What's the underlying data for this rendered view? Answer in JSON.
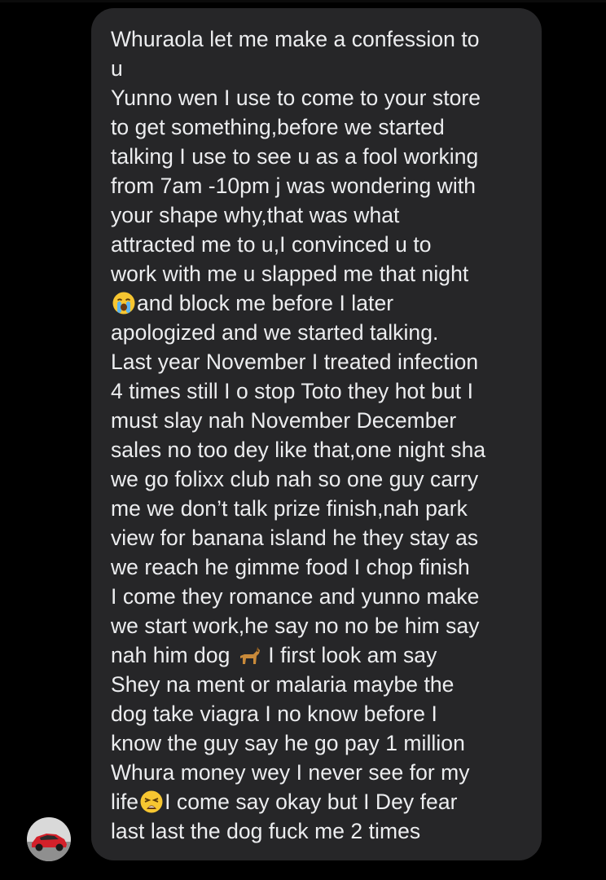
{
  "message": {
    "lines": [
      "Whuraola let me make a confession to",
      "u",
      "Yunno wen I use to come to your store",
      "to get something,before we started",
      "talking I use to see u as a fool working",
      "from 7am -10pm j was wondering with",
      "your shape why,that was what",
      "attracted me to u,I convinced u to",
      "work with me u slapped me that night",
      "and block me before I later",
      "apologized and we started talking.",
      "Last year November I treated infection",
      "4 times still I o stop Toto they hot but I",
      "must slay  nah November December",
      "sales no too dey like that,one night sha",
      "we go folixx club nah so one guy carry",
      "me we don’t talk prize finish,nah park",
      "view for banana island he they stay as",
      "we reach he gimme food I chop finish",
      "I come they romance and yunno make",
      "we start work,he say no no be him say",
      "nah him dog",
      "I first look am say",
      "Shey na ment or malaria maybe the",
      "dog take viagra I no know before I",
      "know the guy say he go pay 1 million",
      "Whura money wey I never see for my",
      "life",
      "I come say okay but I Dey fear",
      "last last the dog fuck me 2 times"
    ],
    "icons": {
      "crying": "loudly-crying-face-emoji",
      "dog": "dog-emoji",
      "weary": "weary-face-emoji",
      "avatar": "red-sports-car-avatar"
    }
  },
  "colors": {
    "background": "#000000",
    "bubble": "#262628",
    "text": "#ecedef"
  }
}
